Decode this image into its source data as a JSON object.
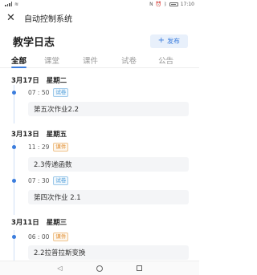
{
  "status_bar": {
    "time": "17:10"
  },
  "header": {
    "close_icon": "close-icon",
    "title": "自动控制系统"
  },
  "page": {
    "title": "教学日志",
    "publish_button": {
      "icon": "+",
      "label": "发布"
    }
  },
  "tabs": [
    {
      "label": "全部",
      "active": true
    },
    {
      "label": "课堂",
      "active": false
    },
    {
      "label": "课件",
      "active": false
    },
    {
      "label": "试卷",
      "active": false
    },
    {
      "label": "公告",
      "active": false
    }
  ],
  "groups": [
    {
      "date": "3月17日",
      "weekday": "星期二",
      "entries": [
        {
          "time": "07 : 50",
          "tag": "试卷",
          "tag_color": "#4a9ad8",
          "text": "第五次作业2.2"
        }
      ]
    },
    {
      "date": "3月13日",
      "weekday": "星期五",
      "entries": [
        {
          "time": "11 : 29",
          "tag": "课件",
          "tag_color": "#e08a2b",
          "text": "2.3传递函数"
        },
        {
          "time": "07 : 30",
          "tag": "试卷",
          "tag_color": "#4a9ad8",
          "text": "第四次作业 2.1"
        }
      ]
    },
    {
      "date": "3月11日",
      "weekday": "星期三",
      "entries": [
        {
          "time": "06 : 00",
          "tag": "课件",
          "tag_color": "#e08a2b",
          "text": "2.2拉普拉斯变换"
        }
      ]
    }
  ],
  "colors": {
    "accent": "#3b7ddd",
    "tag_blue": "#4a9ad8",
    "tag_orange": "#e08a2b"
  }
}
